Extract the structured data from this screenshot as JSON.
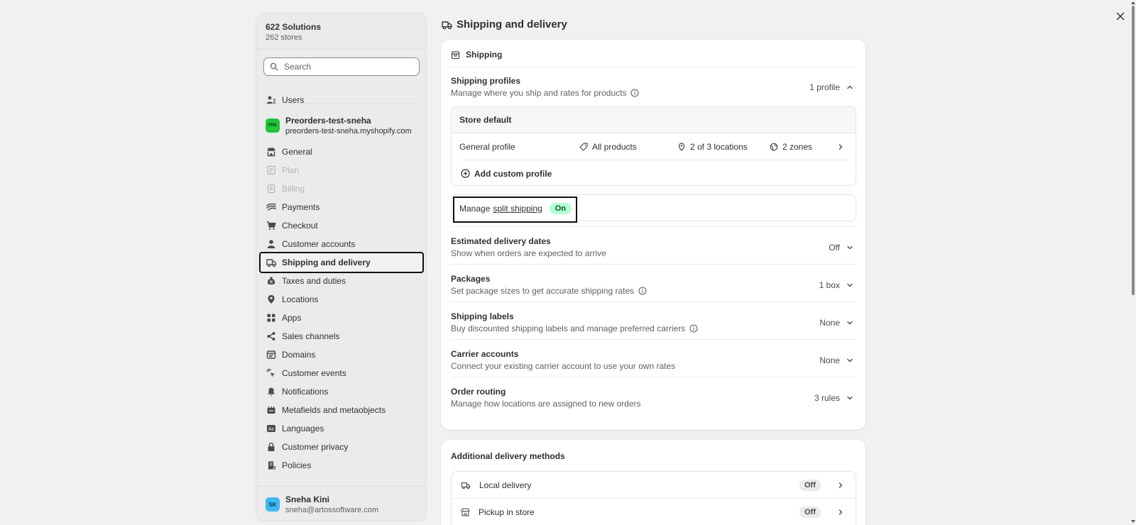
{
  "sidebar": {
    "org_name": "622 Solutions",
    "org_stores": "262 stores",
    "search_placeholder": "Search",
    "users_label": "Users",
    "store": {
      "logo_text": "PRE",
      "name": "Preorders-test-sneha",
      "url": "preorders-test-sneha.myshopify.com"
    },
    "items": [
      {
        "label": "General",
        "icon": "store-icon"
      },
      {
        "label": "Plan",
        "icon": "plan-icon"
      },
      {
        "label": "Billing",
        "icon": "billing-icon"
      },
      {
        "label": "Payments",
        "icon": "payments-icon"
      },
      {
        "label": "Checkout",
        "icon": "cart-icon"
      },
      {
        "label": "Customer accounts",
        "icon": "person-icon"
      },
      {
        "label": "Shipping and delivery",
        "icon": "truck-icon"
      },
      {
        "label": "Taxes and duties",
        "icon": "tax-icon"
      },
      {
        "label": "Locations",
        "icon": "location-icon"
      },
      {
        "label": "Apps",
        "icon": "apps-icon"
      },
      {
        "label": "Sales channels",
        "icon": "channels-icon"
      },
      {
        "label": "Domains",
        "icon": "domains-icon"
      },
      {
        "label": "Customer events",
        "icon": "cursor-icon"
      },
      {
        "label": "Notifications",
        "icon": "bell-icon"
      },
      {
        "label": "Metafields and metaobjects",
        "icon": "metafields-icon"
      },
      {
        "label": "Languages",
        "icon": "languages-icon"
      },
      {
        "label": "Customer privacy",
        "icon": "lock-icon"
      },
      {
        "label": "Policies",
        "icon": "policies-icon"
      }
    ],
    "user": {
      "initials": "SK",
      "name": "Sneha Kini",
      "email": "sneha@artossoftware.com"
    }
  },
  "main": {
    "title": "Shipping and delivery",
    "shipping_card": {
      "heading": "Shipping",
      "profiles": {
        "title": "Shipping profiles",
        "desc": "Manage where you ship and rates for products",
        "value": "1 profile"
      },
      "store_default": {
        "heading": "Store default",
        "profile_name": "General profile",
        "products": "All products",
        "locations": "2 of 3 locations",
        "zones": "2 zones",
        "add_custom": "Add custom profile"
      },
      "split": {
        "prefix": "Manage",
        "link": "split shipping",
        "badge": "On"
      },
      "rows": [
        {
          "title": "Estimated delivery dates",
          "desc": "Show when orders are expected to arrive",
          "value": "Off",
          "info": false
        },
        {
          "title": "Packages",
          "desc": "Set package sizes to get accurate shipping rates",
          "value": "1 box",
          "info": true
        },
        {
          "title": "Shipping labels",
          "desc": "Buy discounted shipping labels and manage preferred carriers",
          "value": "None",
          "info": true
        },
        {
          "title": "Carrier accounts",
          "desc": "Connect your existing carrier account to use your own rates",
          "value": "None",
          "info": false
        },
        {
          "title": "Order routing",
          "desc": "Manage how locations are assigned to new orders",
          "value": "3 rules",
          "info": false
        }
      ]
    },
    "delivery_card": {
      "heading": "Additional delivery methods",
      "methods": [
        {
          "label": "Local delivery",
          "status": "Off"
        },
        {
          "label": "Pickup in store",
          "status": "Off"
        }
      ]
    }
  }
}
